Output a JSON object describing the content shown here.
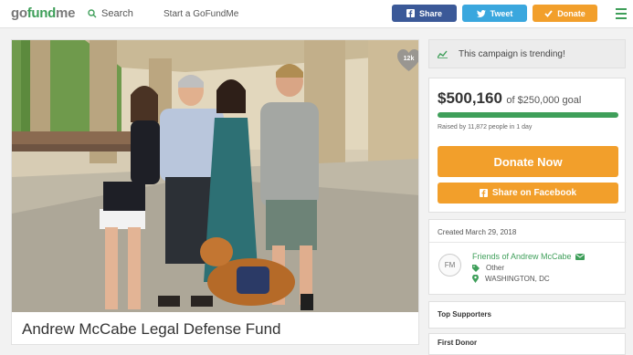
{
  "header": {
    "logo": {
      "g": "go",
      "fund": "fund",
      "me": "me"
    },
    "search_label": "Search",
    "start_label": "Start a GoFundMe",
    "share_label": "Share",
    "tweet_label": "Tweet",
    "donate_label": "Donate"
  },
  "campaign": {
    "title": "Andrew McCabe Legal Defense Fund",
    "hearts_count": "12k",
    "trending": "This campaign is trending!",
    "raised_amount": "$500,160",
    "goal_text": "of $250,000 goal",
    "progress_fraction": 1.0,
    "raised_by": "Raised by 11,872 people in 1 day",
    "donate_now_label": "Donate Now",
    "share_fb_label": "Share on Facebook",
    "created": "Created March 29, 2018"
  },
  "organizer": {
    "initials": "FM",
    "name": "Friends of Andrew McCabe",
    "category": "Other",
    "location": "WASHINGTON, DC"
  },
  "sections": {
    "top_supporters": "Top Supporters",
    "first_donor": "First Donor"
  },
  "colors": {
    "brand_green": "#3f9f5a",
    "donate_orange": "#f29f2b",
    "facebook_blue": "#3b5998",
    "twitter_blue": "#3aa7de"
  }
}
